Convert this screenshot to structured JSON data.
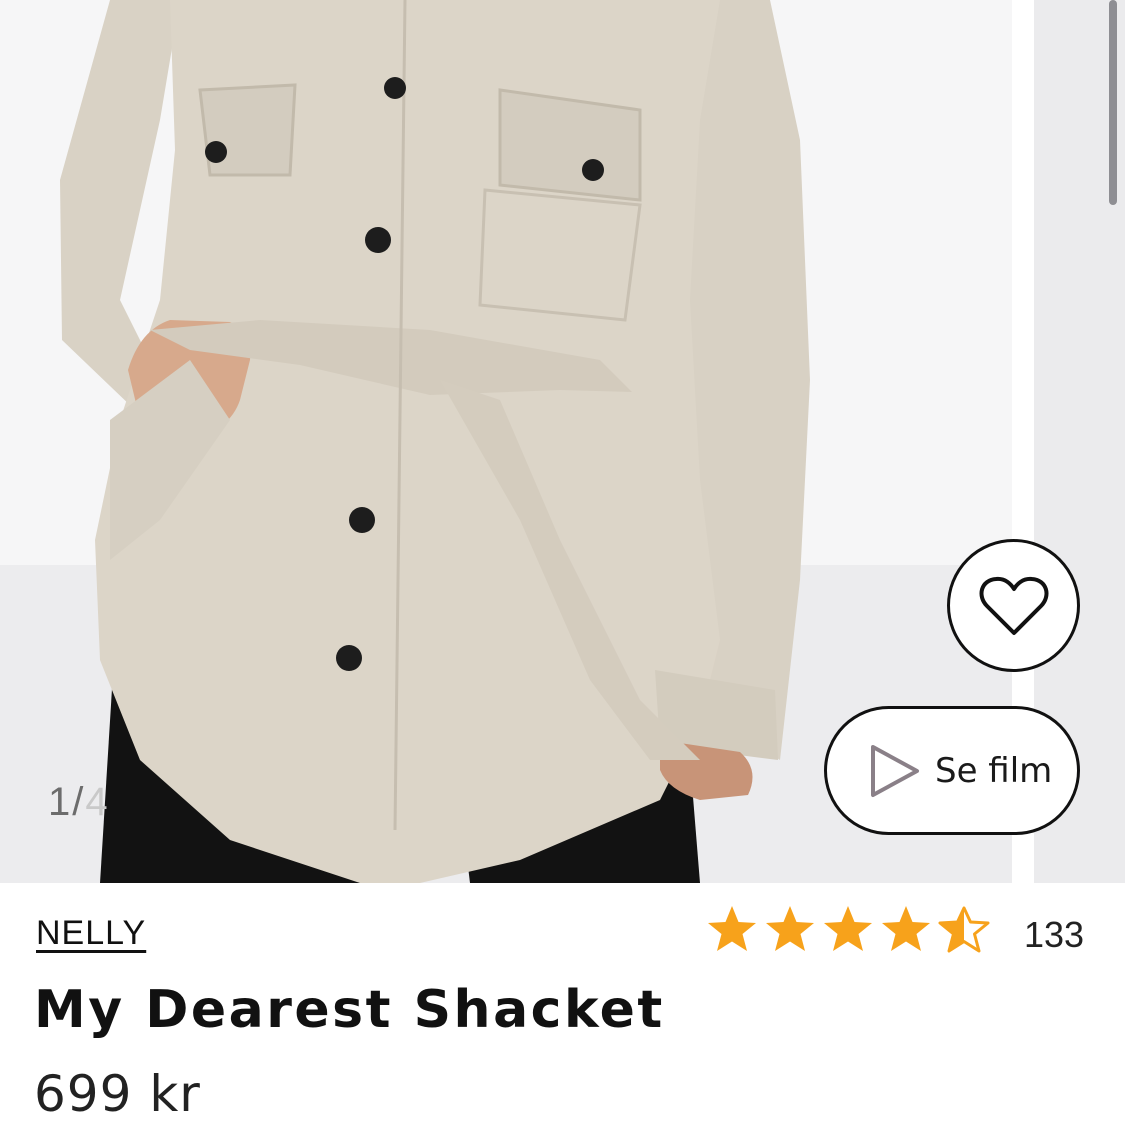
{
  "gallery": {
    "image_alt": "Beige belted shacket worn by model",
    "counter_current": "1",
    "counter_separator": "/",
    "counter_total": "4"
  },
  "actions": {
    "wishlist_icon": "heart-icon",
    "film_icon": "play-icon",
    "film_label": "Se film"
  },
  "product": {
    "brand": "NELLY",
    "name": "My Dearest Shacket",
    "price": "699 kr",
    "rating": 4.5,
    "rating_max": 5,
    "review_count": "133"
  },
  "colors": {
    "star": "#f7a21b",
    "text": "#111111",
    "coat": "#dcd5c8"
  }
}
